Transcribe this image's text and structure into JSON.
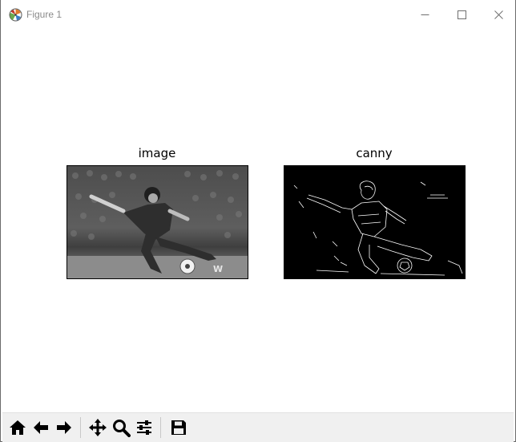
{
  "window": {
    "title": "Figure 1",
    "controls": [
      "minimize",
      "maximize",
      "close"
    ]
  },
  "figure": {
    "subplots": [
      {
        "title": "image",
        "content": "grayscale photograph of a soccer player kicking a ball"
      },
      {
        "title": "canny",
        "content": "canny edge detection of the same photograph (white edges on black)"
      }
    ]
  },
  "toolbar": {
    "buttons": [
      {
        "icon": "home-icon",
        "action": "home"
      },
      {
        "icon": "back-arrow-icon",
        "action": "back"
      },
      {
        "icon": "forward-arrow-icon",
        "action": "forward"
      },
      {
        "icon": "pan-icon",
        "action": "pan"
      },
      {
        "icon": "zoom-icon",
        "action": "zoom"
      },
      {
        "icon": "configure-subplots-icon",
        "action": "subplots"
      },
      {
        "icon": "save-icon",
        "action": "save"
      }
    ]
  },
  "colors": {
    "window_bg": "#ffffff",
    "toolbar_bg": "#f0f0f0",
    "edge_image_bg": "#000000",
    "edge_lines": "#ffffff"
  }
}
